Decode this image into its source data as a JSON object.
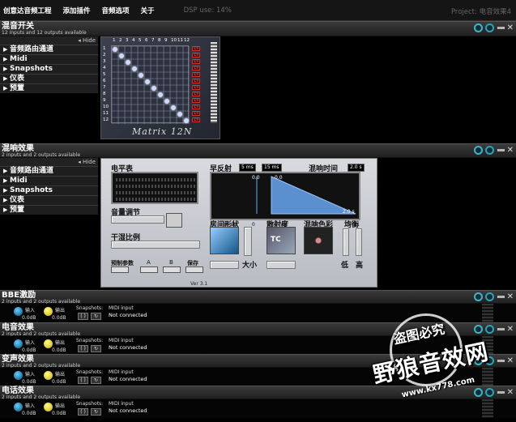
{
  "menu": {
    "items": [
      "创意达音频工程",
      "添加插件",
      "音频选项",
      "关于"
    ],
    "dsp_label": "DSP use: 14%",
    "project_label": "Project: 电音效果4"
  },
  "plugins": [
    {
      "title": "混音开关",
      "subtitle": "12 inputs and 12 outputs available"
    },
    {
      "title": "混响效果",
      "subtitle": "2 inputs and 2 outputs available"
    },
    {
      "title": "BBE激励",
      "subtitle": "2 inputs and 2 outputs available"
    },
    {
      "title": "电音效果",
      "subtitle": "2 inputs and 2 outputs available"
    },
    {
      "title": "变声效果",
      "subtitle": "2 inputs and 2 outputs available"
    },
    {
      "title": "电话效果",
      "subtitle": "2 inputs and 2 outputs available"
    }
  ],
  "side_menu": {
    "hide_label": "◂ Hide",
    "items": [
      "音频路由通道",
      "Midi",
      "Snapshots",
      "仪表",
      "预置"
    ]
  },
  "matrix": {
    "logo": "Matrix 12N",
    "column_numbers": [
      "1",
      "2",
      "3",
      "4",
      "5",
      "6",
      "7",
      "8",
      "9",
      "10",
      "11",
      "12"
    ],
    "row_numbers": [
      "1",
      "2",
      "3",
      "4",
      "5",
      "6",
      "7",
      "8",
      "9",
      "10",
      "11",
      "12"
    ],
    "red_label": "IDX"
  },
  "reverb": {
    "level_meter": "电平表",
    "volume": "音量调节",
    "dry_wet": "干湿比例",
    "early_reflection": "早反射",
    "early_value": "5 ms",
    "early_value2": "15 ms",
    "reverb_time": "混响时间",
    "reverb_time_value": "2.0 s",
    "env_left": "0.0",
    "env_right": "0.0",
    "env_end": "2.0 s",
    "room_shape": "房间形状",
    "diffusion": "散射度",
    "reverb_color": "混响色彩",
    "balance": "均衡",
    "size": "大小",
    "low": "低",
    "high": "高",
    "preset": "预制参数",
    "a": "A",
    "b": "B",
    "save": "保存",
    "version": "Ver 3.1",
    "axis_labels": [
      "0",
      "10 ms",
      "0",
      "100 ms",
      "0",
      "10 ms"
    ],
    "tc_label": "TC"
  },
  "rows": {
    "input_label": "输入",
    "output_label": "输出",
    "input_value": "0.0dB",
    "output_value": "0.0dB",
    "snapshots_label": "Snapshots:",
    "midi_label": "MIDI input",
    "midi_value": "Not connected"
  },
  "watermark": {
    "line1": "盗图必究",
    "line2": "野狼音效网",
    "line3": "www.kx778.com"
  },
  "colors": {
    "accent_ring": "#3fb3c8",
    "panel_bg": "#000000"
  }
}
